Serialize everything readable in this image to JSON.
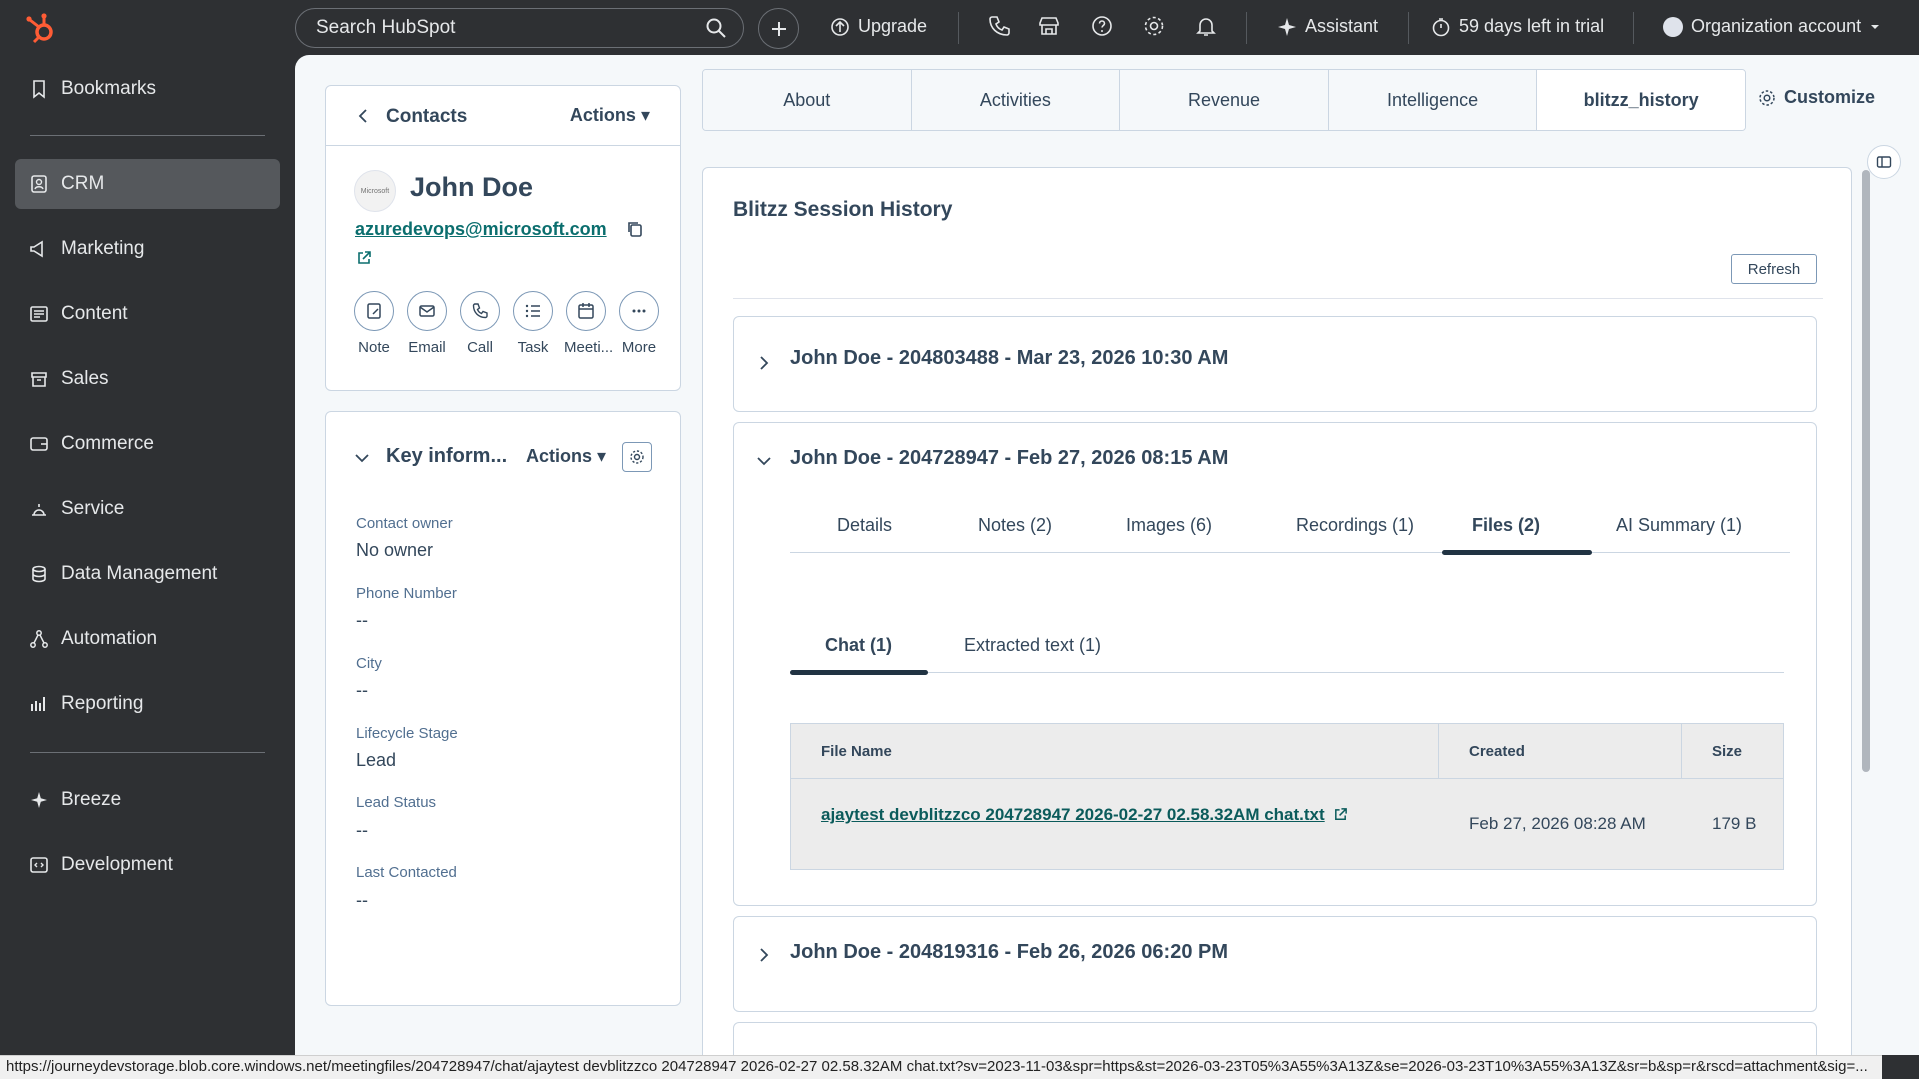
{
  "topbar": {
    "search_placeholder": "Search HubSpot",
    "upgrade": "Upgrade",
    "assistant": "Assistant",
    "trial": "59 days left in trial",
    "account": "Organization account"
  },
  "sidebar": {
    "items": [
      {
        "label": "Bookmarks",
        "icon": "bookmark-icon"
      },
      {
        "label": "CRM",
        "icon": "crm-icon",
        "active": true
      },
      {
        "label": "Marketing",
        "icon": "megaphone-icon"
      },
      {
        "label": "Content",
        "icon": "content-icon"
      },
      {
        "label": "Sales",
        "icon": "sales-icon"
      },
      {
        "label": "Commerce",
        "icon": "commerce-icon"
      },
      {
        "label": "Service",
        "icon": "service-icon"
      },
      {
        "label": "Data Management",
        "icon": "database-icon"
      },
      {
        "label": "Automation",
        "icon": "automation-icon"
      },
      {
        "label": "Reporting",
        "icon": "reporting-icon"
      },
      {
        "label": "Breeze",
        "icon": "sparkle-icon"
      },
      {
        "label": "Development",
        "icon": "code-icon"
      }
    ]
  },
  "contact_header": {
    "back_label": "Contacts",
    "actions_label": "Actions",
    "company_logo_text": "Microsoft",
    "name": "John Doe",
    "email": "azuredevops@microsoft.com",
    "quick_actions": [
      "Note",
      "Email",
      "Call",
      "Task",
      "Meeti...",
      "More"
    ]
  },
  "key_info": {
    "title": "Key inform...",
    "actions_label": "Actions",
    "properties": [
      {
        "label": "Contact owner",
        "value": "No owner"
      },
      {
        "label": "Phone Number",
        "value": "--"
      },
      {
        "label": "City",
        "value": "--"
      },
      {
        "label": "Lifecycle Stage",
        "value": "Lead"
      },
      {
        "label": "Lead Status",
        "value": "--"
      },
      {
        "label": "Last Contacted",
        "value": "--"
      }
    ]
  },
  "record_tabs": [
    "About",
    "Activities",
    "Revenue",
    "Intelligence",
    "blitzz_history"
  ],
  "customize_label": "Customize",
  "panel": {
    "title": "Blitzz Session History",
    "refresh_label": "Refresh",
    "sessions": [
      {
        "title": "John Doe - 204803488 - Mar 23, 2026 10:30 AM",
        "expanded": false
      },
      {
        "title": "John Doe - 204728947 - Feb 27, 2026 08:15 AM",
        "expanded": true
      },
      {
        "title": "John Doe - 204819316 - Feb 26, 2026 06:20 PM",
        "expanded": false
      }
    ],
    "subtabs": [
      "Details",
      "Notes (2)",
      "Images (6)",
      "Recordings (1)",
      "Files (2)",
      "AI Summary (1)"
    ],
    "active_subtab": "Files (2)",
    "innertabs": [
      "Chat (1)",
      "Extracted text (1)"
    ],
    "active_innertab": "Chat (1)",
    "files_table": {
      "headers": [
        "File Name",
        "Created",
        "Size"
      ],
      "rows": [
        {
          "file_name": "ajaytest devblitzzco 204728947 2026-02-27 02.58.32AM chat.txt",
          "created": "Feb 27, 2026 08:28 AM",
          "size": "179 B"
        }
      ]
    }
  },
  "status_url": "https://journeydevstorage.blob.core.windows.net/meetingfiles/204728947/chat/ajaytest devblitzzco 204728947 2026-02-27 02.58.32AM chat.txt?sv=2023-11-03&spr=https&st=2026-03-23T05%3A55%3A13Z&se=2026-03-23T10%3A55%3A13Z&sr=b&sp=r&rscd=attachment&sig=...",
  "colors": {
    "accent_orange": "#ff5c35",
    "link_teal": "#0b6e6e",
    "dark_nav": "#2e3033"
  }
}
